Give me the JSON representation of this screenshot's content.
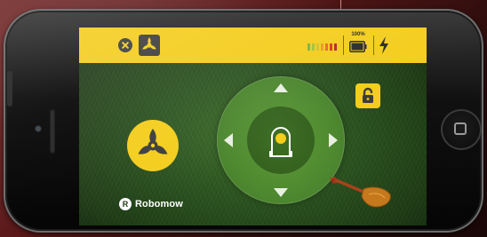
{
  "status_bar": {
    "battery_label": "100%",
    "battery_level": 1.0,
    "signal_icon": "signal-strength-icon",
    "charging_icon": "lightning-bolt-icon"
  },
  "toolbar": {
    "close_icon": "close-icon",
    "mode_icon": "robomow-tri-blade-icon"
  },
  "controls": {
    "lock_icon": "unlock-icon",
    "drive_mode_icon": "robomow-tri-blade-icon",
    "joystick_arrows": [
      "up",
      "down",
      "left",
      "right"
    ],
    "mower_icon": "mower-icon",
    "shovel_icon": "shovel-icon"
  },
  "brand": {
    "mark_letter": "R",
    "name": "Robomow"
  },
  "colors": {
    "accent_yellow": "#f4cd1c",
    "dark_icon": "#3c3c3c",
    "joystick_green": "#4f8a30",
    "arrow_white": "#e9f0e2"
  }
}
